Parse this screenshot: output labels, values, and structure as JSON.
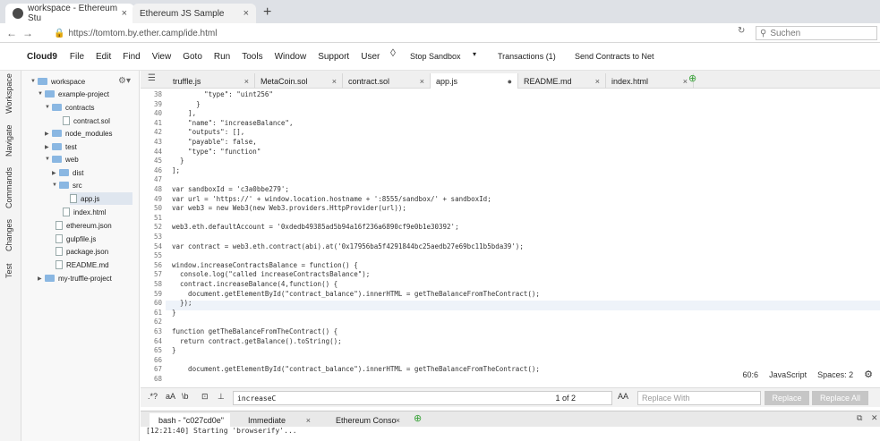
{
  "browser": {
    "tabs": [
      {
        "label": "workspace - Ethereum Stu"
      },
      {
        "label": "Ethereum JS Sample"
      }
    ],
    "url": "https://tomtom.by.ether.camp/ide.html",
    "search_placeholder": "Suchen"
  },
  "menu": {
    "brand": "Cloud9",
    "items": [
      "File",
      "Edit",
      "Find",
      "View",
      "Goto",
      "Run",
      "Tools",
      "Window",
      "Support",
      "User"
    ],
    "stop_sandbox": "Stop Sandbox",
    "transactions": "Transactions (1)",
    "send_contracts": "Send Contracts to Net"
  },
  "side_tabs": [
    "Workspace",
    "Navigate",
    "Commands",
    "Changes",
    "Test"
  ],
  "tree": [
    {
      "label": "workspace",
      "type": "folder"
    },
    {
      "label": "example-project",
      "type": "folder"
    },
    {
      "label": "contracts",
      "type": "folder"
    },
    {
      "label": "contract.sol",
      "type": "file"
    },
    {
      "label": "node_modules",
      "type": "folder"
    },
    {
      "label": "test",
      "type": "folder"
    },
    {
      "label": "web",
      "type": "folder"
    },
    {
      "label": "dist",
      "type": "folder"
    },
    {
      "label": "src",
      "type": "folder"
    },
    {
      "label": "app.js",
      "type": "file"
    },
    {
      "label": "index.html",
      "type": "file"
    },
    {
      "label": "ethereum.json",
      "type": "file"
    },
    {
      "label": "gulpfile.js",
      "type": "file"
    },
    {
      "label": "package.json",
      "type": "file"
    },
    {
      "label": "README.md",
      "type": "file"
    },
    {
      "label": "my-truffle-project",
      "type": "folder"
    }
  ],
  "editor_tabs": [
    "truffle.js",
    "MetaCoin.sol",
    "contract.sol",
    "app.js",
    "README.md",
    "index.html"
  ],
  "code": [
    {
      "n": "38",
      "t": "        \"type\": \"uint256\""
    },
    {
      "n": "39",
      "t": "      }"
    },
    {
      "n": "40",
      "t": "    ],"
    },
    {
      "n": "41",
      "t": "    \"name\": \"increaseBalance\","
    },
    {
      "n": "42",
      "t": "    \"outputs\": [],"
    },
    {
      "n": "43",
      "t": "    \"payable\": false,"
    },
    {
      "n": "44",
      "t": "    \"type\": \"function\""
    },
    {
      "n": "45",
      "t": "  }"
    },
    {
      "n": "46",
      "t": "];"
    },
    {
      "n": "47",
      "t": ""
    },
    {
      "n": "48",
      "t": "var sandboxId = 'c3a0bbe279';"
    },
    {
      "n": "49",
      "t": "var url = 'https://' + window.location.hostname + ':8555/sandbox/' + sandboxId;"
    },
    {
      "n": "50",
      "t": "var web3 = new Web3(new Web3.providers.HttpProvider(url));"
    },
    {
      "n": "51",
      "t": ""
    },
    {
      "n": "52",
      "t": "web3.eth.defaultAccount = '0xdedb49385ad5b94a16f236a6890cf9e0b1e30392';"
    },
    {
      "n": "53",
      "t": ""
    },
    {
      "n": "54",
      "t": "var contract = web3.eth.contract(abi).at('0x17956ba5f4291844bc25aedb27e69bc11b5bda39');"
    },
    {
      "n": "55",
      "t": ""
    },
    {
      "n": "56",
      "t": "window.increaseContractsBalance = function() {"
    },
    {
      "n": "57",
      "t": "  console.log(\"called increaseContractsBalance\");"
    },
    {
      "n": "58",
      "t": "  contract.increaseBalance(4,function() {"
    },
    {
      "n": "59",
      "t": "    document.getElementById(\"contract_balance\").innerHTML = getTheBalanceFromTheContract();"
    },
    {
      "n": "60",
      "t": "  });"
    },
    {
      "n": "61",
      "t": "}"
    },
    {
      "n": "62",
      "t": ""
    },
    {
      "n": "63",
      "t": "function getTheBalanceFromTheContract() {"
    },
    {
      "n": "64",
      "t": "  return contract.getBalance().toString();"
    },
    {
      "n": "65",
      "t": "}"
    },
    {
      "n": "66",
      "t": ""
    },
    {
      "n": "67",
      "t": "    document.getElementById(\"contract_balance\").innerHTML = getTheBalanceFromTheContract();"
    },
    {
      "n": "68",
      "t": ""
    }
  ],
  "status": {
    "position": "60:6",
    "language": "JavaScript",
    "spaces": "Spaces: 2"
  },
  "find": {
    "regex": ".*?",
    "case": "aA",
    "word": "\\b",
    "query": "increaseC",
    "count": "1 of 2",
    "replace_case": "AA",
    "replace_placeholder": "Replace With",
    "replace_label": "Replace",
    "replace_all_label": "Replace All"
  },
  "terminal": {
    "tabs": [
      "bash - \"c027cd0e\"",
      "Immediate",
      "Ethereum Conso"
    ],
    "line": "[12:21:40] Starting 'browserify'..."
  }
}
